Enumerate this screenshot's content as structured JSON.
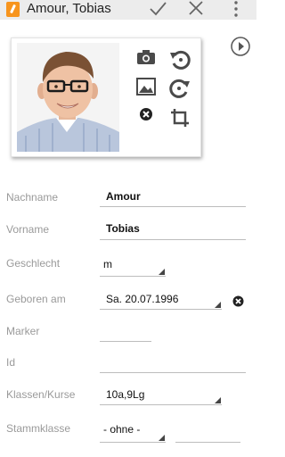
{
  "app_bar": {
    "title": "Amour, Tobias",
    "icons": [
      "app-logo-icon",
      "check-icon",
      "close-icon",
      "more-vert-icon"
    ]
  },
  "photo_card": {
    "icons": [
      "camera-icon",
      "image-icon",
      "delete-icon",
      "rotate-left-icon",
      "rotate-right-icon",
      "crop-icon"
    ]
  },
  "side": {
    "icon": "play-arrow-icon"
  },
  "form": {
    "fields": [
      {
        "label": "Nachname",
        "value": "Amour"
      },
      {
        "label": "Vorname",
        "value": "Tobias"
      },
      {
        "label": "Geschlecht",
        "value": "m"
      },
      {
        "label": "Geboren am",
        "value": "Sa. 20.07.1996"
      },
      {
        "label": "Marker",
        "value": ""
      },
      {
        "label": "Id",
        "value": ""
      },
      {
        "label": "Klassen/Kurse",
        "value": "10a,9Lg"
      },
      {
        "label": "Stammklasse",
        "value": "- ohne -"
      }
    ]
  },
  "colors": {
    "app_icon": "#f7941d",
    "label": "#9a9a9a",
    "underline": "#bdbdbd",
    "appbar_bg": "#ececec"
  }
}
